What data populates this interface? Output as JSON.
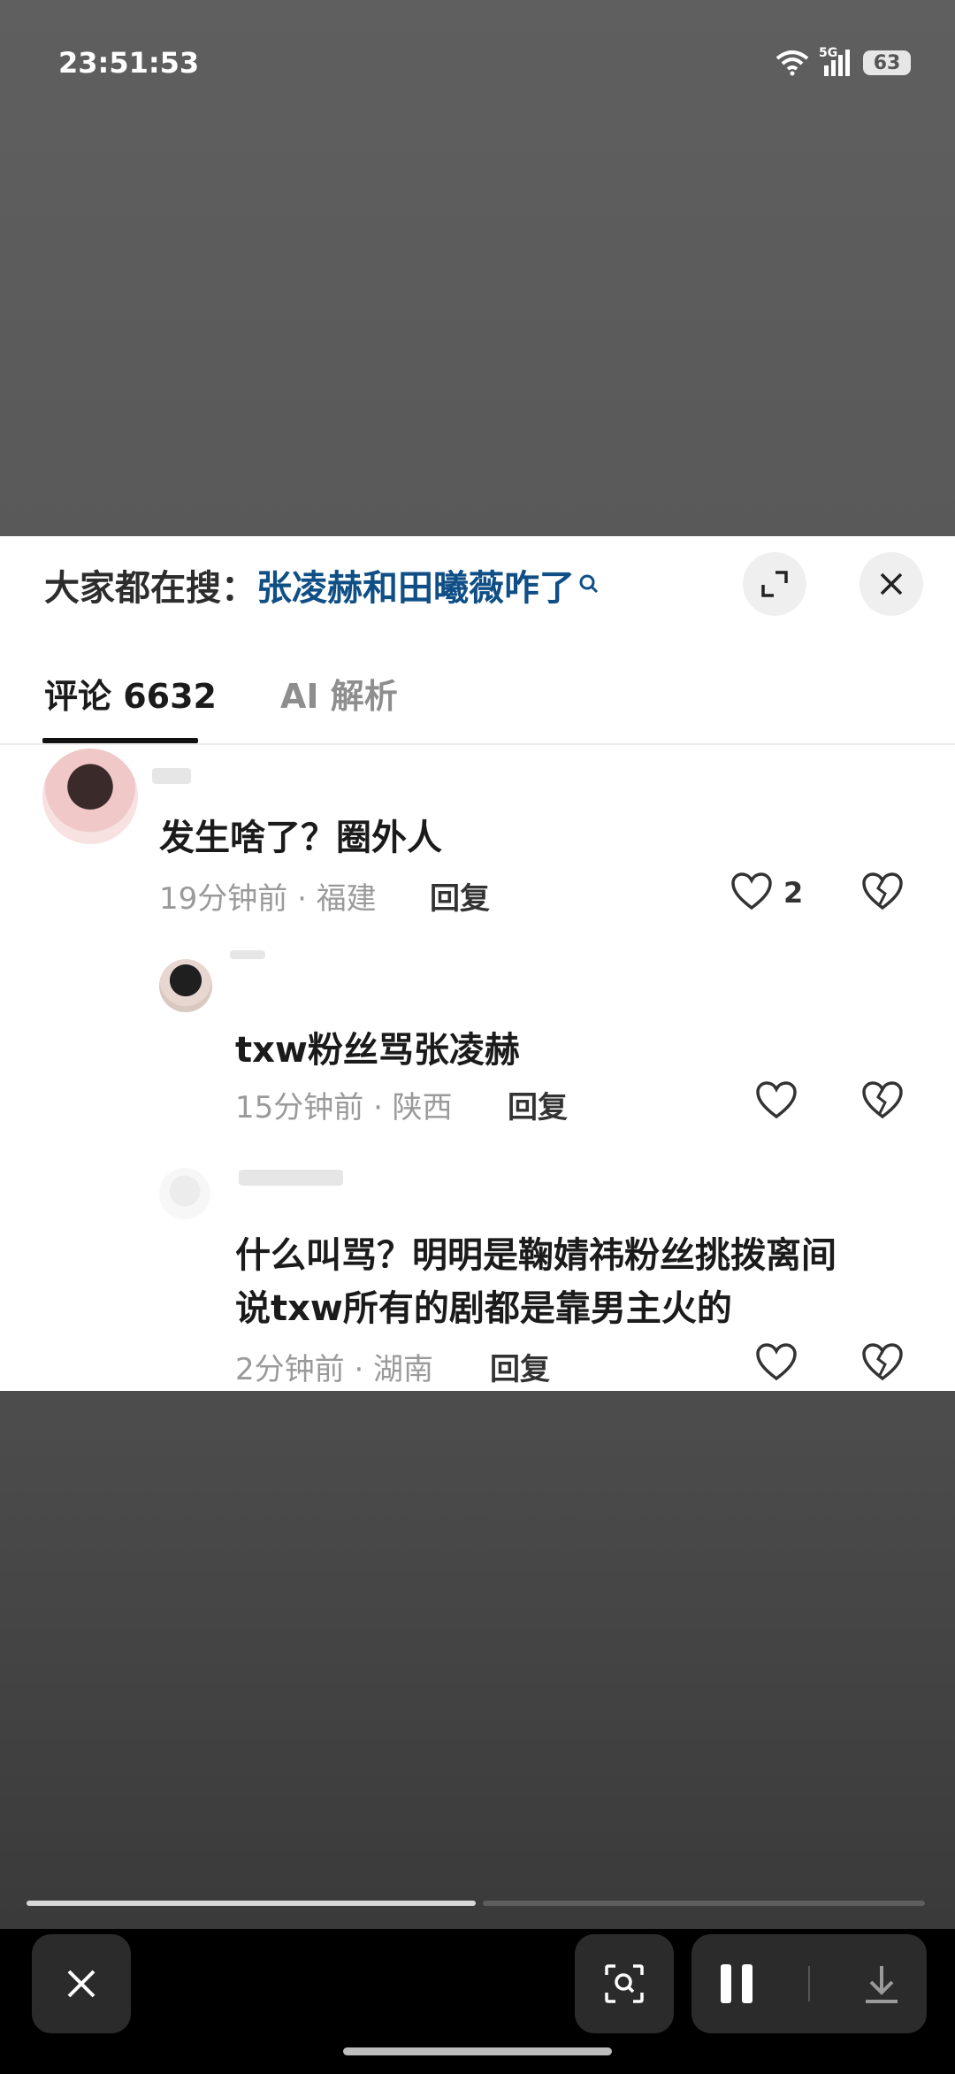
{
  "status_bar": {
    "time": "23:51:53",
    "network": "5G",
    "battery": "63"
  },
  "panel": {
    "search_prefix": "大家都在搜：",
    "search_query": "张凌赫和田曦薇咋了",
    "tabs": [
      {
        "label": "评论 6632",
        "active": true
      },
      {
        "label": "AI 解析",
        "active": false
      }
    ]
  },
  "comments": [
    {
      "text": "发生啥了？圈外人",
      "meta": "19分钟前 · 福建",
      "reply_label": "回复",
      "likes": "2"
    },
    {
      "text": "txw粉丝骂张凌赫",
      "meta": "15分钟前 · 陕西",
      "reply_label": "回复"
    },
    {
      "text_line1": "什么叫骂？明明是鞠婧祎粉丝挑拨离间",
      "text_line2": "说txw所有的剧都是靠男主火的",
      "meta": "2分钟前 · 湖南",
      "reply_label": "回复"
    }
  ],
  "player": {
    "progress_fraction": 0.5,
    "icons": [
      "close-icon",
      "screen-search-icon",
      "pause-icon",
      "download-icon"
    ]
  },
  "colors": {
    "accent_link": "#0f4f86",
    "panel_bg": "#ffffff",
    "backdrop": "#5c5c5c"
  }
}
